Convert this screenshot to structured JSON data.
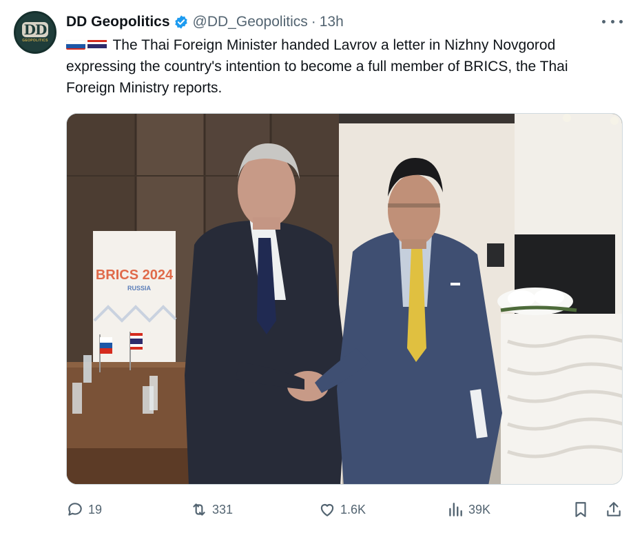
{
  "account": {
    "avatar_text": "DD",
    "avatar_sub": "GEOPOLITICS",
    "display_name": "DD Geopolitics",
    "handle": "@DD_Geopolitics",
    "separator": "·",
    "time": "13h"
  },
  "post": {
    "text": "The Thai Foreign Minister handed Lavrov a letter in Nizhny Novgorod expressing the country's intention to become a full member of BRICS, the Thai Foreign Ministry reports.",
    "flags": [
      "russia-flag",
      "thailand-flag"
    ]
  },
  "media": {
    "banner_line1": "BRICS 2024",
    "banner_line2": "RUSSIA"
  },
  "actions": {
    "replies": "19",
    "reposts": "331",
    "likes": "1.6K",
    "views": "39K"
  },
  "colors": {
    "text": "#0f1419",
    "secondary": "#536471",
    "verified": "#1d9bf0",
    "border": "#cfd9de"
  },
  "icons": [
    "more-icon",
    "verified-icon",
    "reply-icon",
    "retweet-icon",
    "like-icon",
    "views-icon",
    "bookmark-icon",
    "share-icon"
  ]
}
